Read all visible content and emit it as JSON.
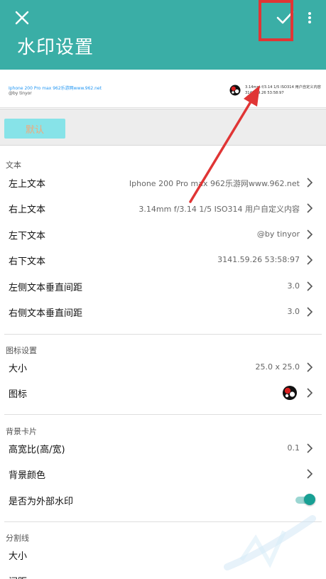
{
  "header": {
    "title": "水印设置",
    "close_icon": "close-icon",
    "confirm_icon": "check-icon",
    "menu_icon": "more-vert-icon",
    "background": "#3aaea6",
    "highlight_color": "#e03535"
  },
  "preview": {
    "top_left": "Iphone 200 Pro max 962乐游网www.962.net",
    "bottom_left": "@by tinyor",
    "top_right": "3.14mm f/3.14 1/5 ISO314 用户自定义内容",
    "bottom_right": "3141.59.26 53:58:97",
    "logo_icon": "watermark-logo-icon"
  },
  "confirm_button": "默认",
  "sections": {
    "text": {
      "header": "文本",
      "rows": [
        {
          "label": "左上文本",
          "value": "Iphone 200 Pro max 962乐游网www.962.net"
        },
        {
          "label": "右上文本",
          "value": "3.14mm f/3.14 1/5 ISO314 用户自定义内容"
        },
        {
          "label": "左下文本",
          "value": "@by tinyor"
        },
        {
          "label": "右下文本",
          "value": "3141.59.26 53:58:97"
        },
        {
          "label": "左侧文本垂直间距",
          "value": "3.0"
        },
        {
          "label": "右侧文本垂直间距",
          "value": "3.0"
        }
      ]
    },
    "icon": {
      "header": "图标设置",
      "rows": [
        {
          "label": "大小",
          "value": "25.0 x 25.0"
        },
        {
          "label": "图标",
          "value": ""
        }
      ]
    },
    "card": {
      "header": "背景卡片",
      "rows": [
        {
          "label": "高宽比(高/宽)",
          "value": "0.1"
        },
        {
          "label": "背景颜色",
          "value": ""
        },
        {
          "label": "是否为外部水印",
          "toggle": true
        }
      ]
    },
    "divider": {
      "header": "分割线",
      "rows": [
        {
          "label": "大小",
          "value": ""
        },
        {
          "label": "间距",
          "value": ""
        }
      ]
    }
  },
  "accent_color": "#18a094",
  "arrow_color": "#e03535"
}
